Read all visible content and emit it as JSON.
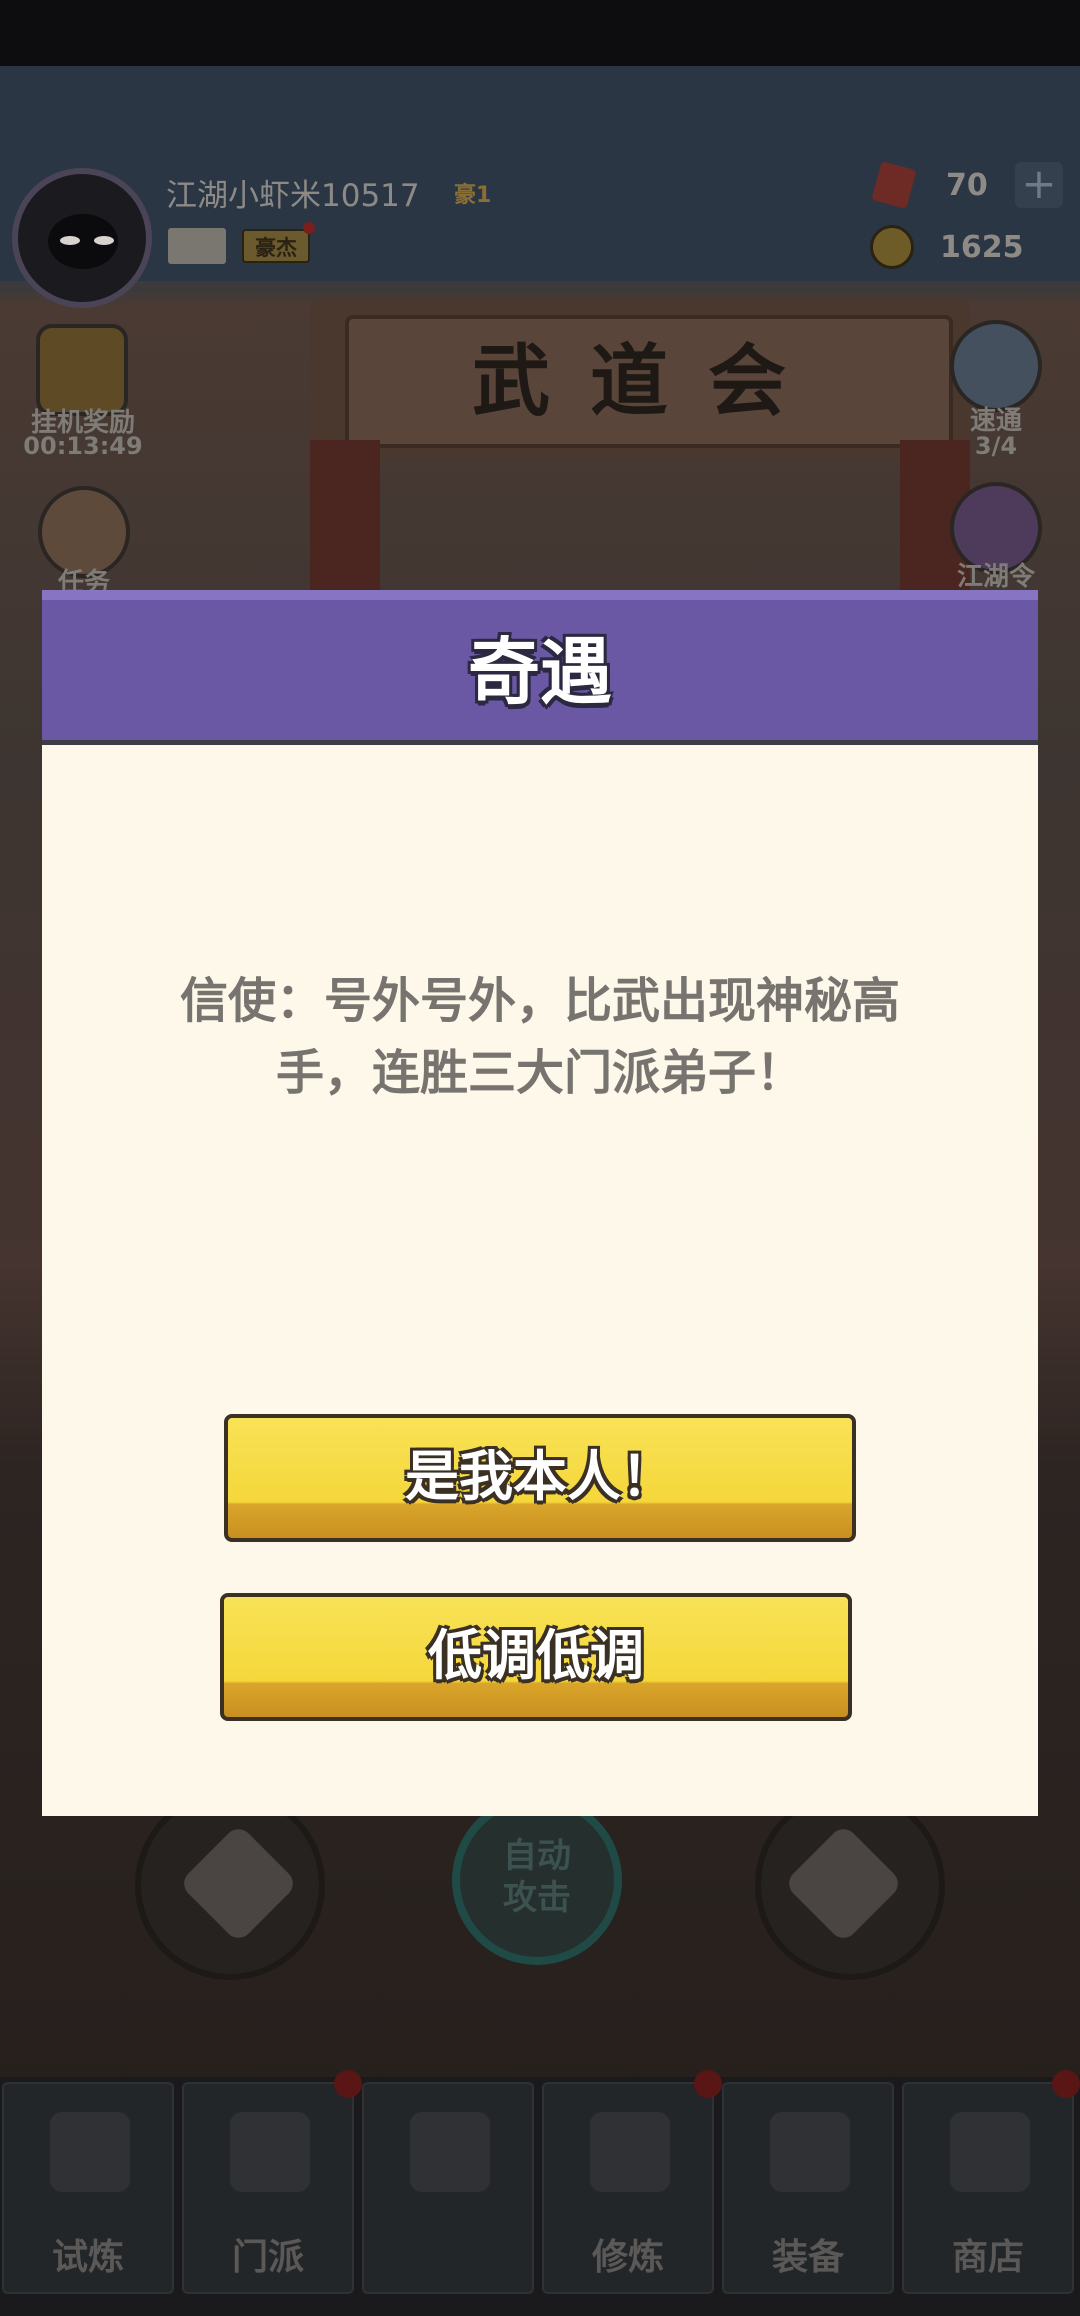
{
  "hud": {
    "player_name": "江湖小虾米10517",
    "rank": "豪1",
    "title_badge": "豪杰",
    "gems": "70",
    "plus": "+",
    "coins": "1625"
  },
  "scene": {
    "gate_sign": "武道会"
  },
  "side_left": {
    "idle_reward_label": "挂机奖励",
    "idle_timer": "00:13:49",
    "task_label": "任务"
  },
  "side_right": {
    "wanted_label": "速通",
    "wanted_count": "3/4",
    "jianghu_label": "江湖令"
  },
  "controls": {
    "auto_attack_line1": "自动",
    "auto_attack_line2": "攻击"
  },
  "bottom_nav": {
    "tabs": [
      {
        "label": "试炼"
      },
      {
        "label": "门派"
      },
      {
        "label": ""
      },
      {
        "label": "修炼"
      },
      {
        "label": "装备"
      },
      {
        "label": "商店"
      }
    ]
  },
  "modal": {
    "title": "奇遇",
    "message": "信使：号外号外，比武出现神秘高手，连胜三大门派弟子！",
    "confirm_button": "是我本人！",
    "lowkey_button": "低调低调"
  },
  "colors": {
    "modal_header": "#6b58a5",
    "modal_body": "#fdf8ea",
    "button_yellow": "#f5d73a"
  }
}
